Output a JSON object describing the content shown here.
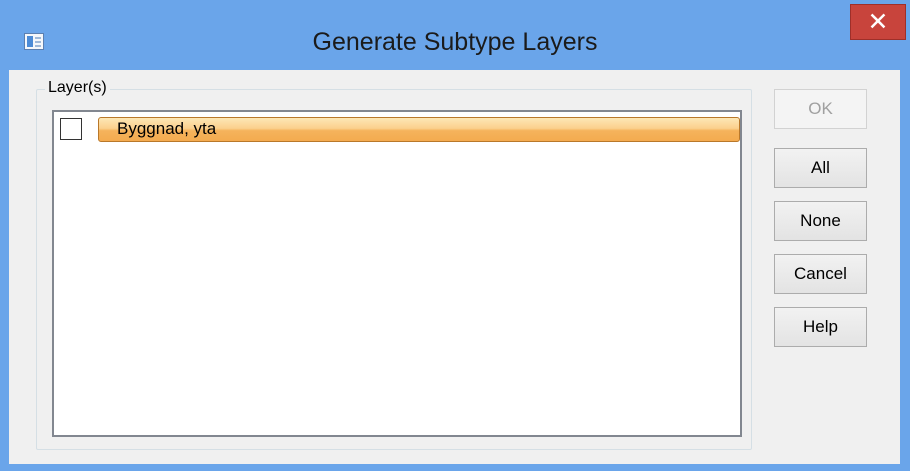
{
  "window": {
    "title": "Generate Subtype Layers",
    "close_glyph": "✕",
    "icon": "app-window-icon"
  },
  "layers": {
    "group_label": "Layer(s)",
    "items": [
      {
        "label": "Byggnad, yta",
        "checked": false,
        "selected": true
      }
    ]
  },
  "buttons": {
    "ok": "OK",
    "all": "All",
    "none": "None",
    "cancel": "Cancel",
    "help": "Help"
  },
  "colors": {
    "selection_highlight": "#f8c06e",
    "titlebar": "#6aa5ea",
    "close_button": "#c8443c"
  }
}
